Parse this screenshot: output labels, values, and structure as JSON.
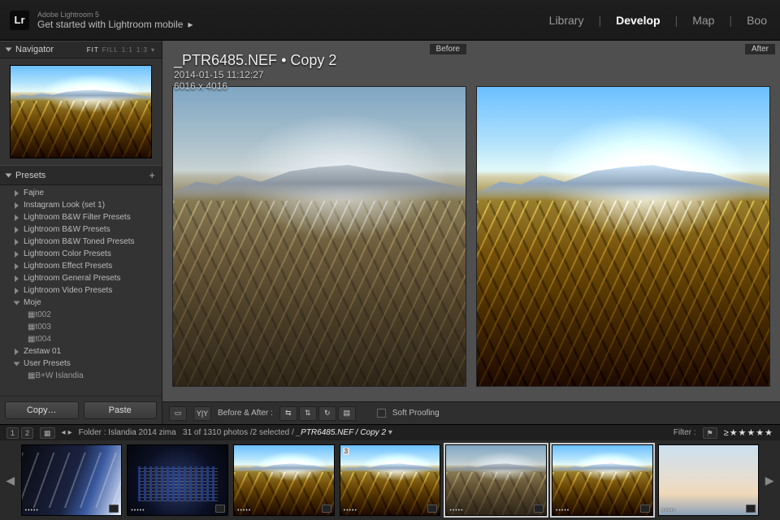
{
  "app": {
    "name": "Adobe Lightroom 5",
    "subtitle": "Get started with Lightroom mobile",
    "logo": "Lr"
  },
  "modules": {
    "items": [
      "Library",
      "Develop",
      "Map",
      "Boo"
    ],
    "active": "Develop"
  },
  "navigator": {
    "title": "Navigator",
    "modes": {
      "fit": "FIT",
      "fill": "FILL",
      "z1": "1:1",
      "z2": "1:3"
    }
  },
  "presets": {
    "title": "Presets",
    "items": [
      {
        "label": "Fajne",
        "kind": "folder"
      },
      {
        "label": "Instagram Look (set 1)",
        "kind": "folder"
      },
      {
        "label": "Lightroom B&W Filter Presets",
        "kind": "folder"
      },
      {
        "label": "Lightroom B&W Presets",
        "kind": "folder"
      },
      {
        "label": "Lightroom B&W Toned Presets",
        "kind": "folder"
      },
      {
        "label": "Lightroom Color Presets",
        "kind": "folder"
      },
      {
        "label": "Lightroom Effect Presets",
        "kind": "folder"
      },
      {
        "label": "Lightroom General Presets",
        "kind": "folder"
      },
      {
        "label": "Lightroom Video Presets",
        "kind": "folder"
      },
      {
        "label": "Moje",
        "kind": "folder-open",
        "children": [
          "t002",
          "t003",
          "t004"
        ]
      },
      {
        "label": "Zestaw 01",
        "kind": "folder"
      },
      {
        "label": "User Presets",
        "kind": "folder-open",
        "children": [
          "B+W Islandia"
        ]
      }
    ],
    "copy_label": "Copy…",
    "paste_label": "Paste"
  },
  "image": {
    "filename": "_PTR6485.NEF",
    "suffix": "Copy 2",
    "timestamp": "2014-01-15 11:12:27",
    "dimensions": "6016 x 4016"
  },
  "compare": {
    "before": "Before",
    "after": "After"
  },
  "toolbar": {
    "label": "Before & After :",
    "soft_proof": "Soft Proofing",
    "yy": "Y|Y"
  },
  "filmstrip_bar": {
    "view1": "1",
    "view2": "2",
    "folder_label": "Folder :",
    "folder_name": "Islandia 2014 zima",
    "count_text": "31 of 1310 photos /2 selected /",
    "current": "_PTR6485.NEF / Copy 2",
    "filter_label": "Filter :",
    "ge": "≥",
    "stars": "★★★★★"
  },
  "filmstrip": {
    "thumbs": [
      {
        "style": "metro",
        "dots": "•••••"
      },
      {
        "style": "dark-city",
        "dots": "•••••"
      },
      {
        "style": "landscape after",
        "dots": "•••••"
      },
      {
        "style": "landscape after",
        "dots": "•••••",
        "num": "3"
      },
      {
        "style": "landscape",
        "dots": "•••••",
        "selected": true
      },
      {
        "style": "landscape after",
        "dots": "•••••",
        "selected": true
      },
      {
        "style": "pale-sky",
        "dots": "•••••"
      }
    ]
  }
}
